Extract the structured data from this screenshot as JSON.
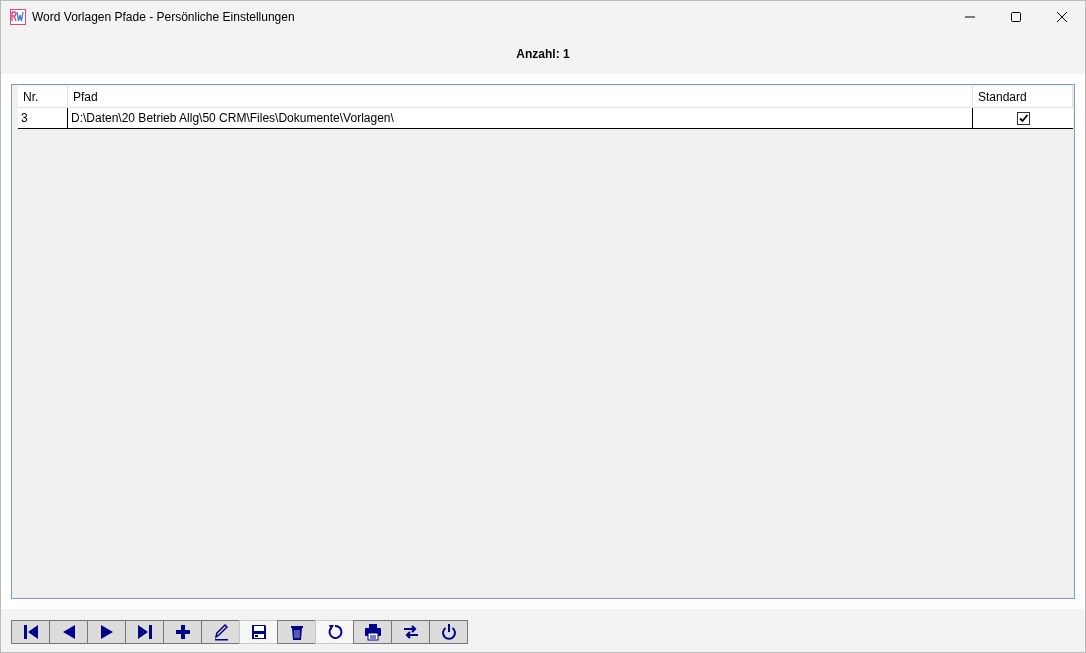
{
  "window": {
    "title": "Word Vorlagen Pfade - Persönliche Einstellungen"
  },
  "count_label": "Anzahl: 1",
  "table": {
    "columns": [
      "Nr.",
      "Pfad",
      "Standard"
    ],
    "rows": [
      {
        "nr": "3",
        "pfad": "D:\\Daten\\20 Betrieb Allg\\50 CRM\\Files\\Dokumente\\Vorlagen\\",
        "checked": true
      }
    ]
  },
  "toolbar": [
    {
      "kind": "first",
      "disabled": false
    },
    {
      "kind": "prev",
      "disabled": false
    },
    {
      "kind": "next",
      "disabled": false
    },
    {
      "kind": "last",
      "disabled": false
    },
    {
      "kind": "add",
      "disabled": false
    },
    {
      "kind": "edit",
      "disabled": false
    },
    {
      "kind": "save",
      "disabled": true
    },
    {
      "kind": "delete",
      "disabled": false
    },
    {
      "kind": "undo",
      "disabled": true
    },
    {
      "kind": "print",
      "disabled": false
    },
    {
      "kind": "swap",
      "disabled": false
    },
    {
      "kind": "power",
      "disabled": false
    }
  ]
}
